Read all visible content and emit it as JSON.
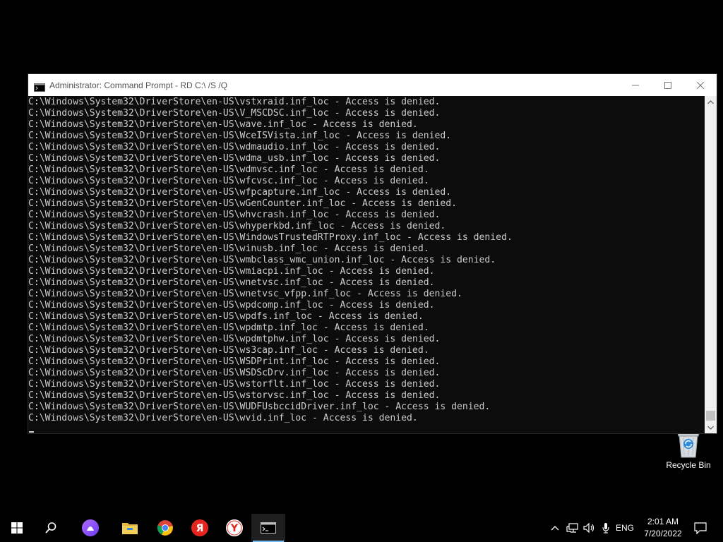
{
  "window": {
    "title": "Administrator: Command Prompt - RD  C:\\ /S /Q",
    "minimize_glyph": "—",
    "maximize_glyph": "☐",
    "close_glyph": "✕"
  },
  "console": {
    "lines": [
      "C:\\Windows\\System32\\DriverStore\\en-US\\vstxraid.inf_loc - Access is denied.",
      "C:\\Windows\\System32\\DriverStore\\en-US\\V_MSCDSC.inf_loc - Access is denied.",
      "C:\\Windows\\System32\\DriverStore\\en-US\\wave.inf_loc - Access is denied.",
      "C:\\Windows\\System32\\DriverStore\\en-US\\WceISVista.inf_loc - Access is denied.",
      "C:\\Windows\\System32\\DriverStore\\en-US\\wdmaudio.inf_loc - Access is denied.",
      "C:\\Windows\\System32\\DriverStore\\en-US\\wdma_usb.inf_loc - Access is denied.",
      "C:\\Windows\\System32\\DriverStore\\en-US\\wdmvsc.inf_loc - Access is denied.",
      "C:\\Windows\\System32\\DriverStore\\en-US\\wfcvsc.inf_loc - Access is denied.",
      "C:\\Windows\\System32\\DriverStore\\en-US\\wfpcapture.inf_loc - Access is denied.",
      "C:\\Windows\\System32\\DriverStore\\en-US\\wGenCounter.inf_loc - Access is denied.",
      "C:\\Windows\\System32\\DriverStore\\en-US\\whvcrash.inf_loc - Access is denied.",
      "C:\\Windows\\System32\\DriverStore\\en-US\\whyperkbd.inf_loc - Access is denied.",
      "C:\\Windows\\System32\\DriverStore\\en-US\\WindowsTrustedRTProxy.inf_loc - Access is denied.",
      "C:\\Windows\\System32\\DriverStore\\en-US\\winusb.inf_loc - Access is denied.",
      "C:\\Windows\\System32\\DriverStore\\en-US\\wmbclass_wmc_union.inf_loc - Access is denied.",
      "C:\\Windows\\System32\\DriverStore\\en-US\\wmiacpi.inf_loc - Access is denied.",
      "C:\\Windows\\System32\\DriverStore\\en-US\\wnetvsc.inf_loc - Access is denied.",
      "C:\\Windows\\System32\\DriverStore\\en-US\\wnetvsc_vfpp.inf_loc - Access is denied.",
      "C:\\Windows\\System32\\DriverStore\\en-US\\wpdcomp.inf_loc - Access is denied.",
      "C:\\Windows\\System32\\DriverStore\\en-US\\wpdfs.inf_loc - Access is denied.",
      "C:\\Windows\\System32\\DriverStore\\en-US\\wpdmtp.inf_loc - Access is denied.",
      "C:\\Windows\\System32\\DriverStore\\en-US\\wpdmtphw.inf_loc - Access is denied.",
      "C:\\Windows\\System32\\DriverStore\\en-US\\ws3cap.inf_loc - Access is denied.",
      "C:\\Windows\\System32\\DriverStore\\en-US\\WSDPrint.inf_loc - Access is denied.",
      "C:\\Windows\\System32\\DriverStore\\en-US\\WSDScDrv.inf_loc - Access is denied.",
      "C:\\Windows\\System32\\DriverStore\\en-US\\wstorflt.inf_loc - Access is denied.",
      "C:\\Windows\\System32\\DriverStore\\en-US\\wstorvsc.inf_loc - Access is denied.",
      "C:\\Windows\\System32\\DriverStore\\en-US\\WUDFUsbccidDriver.inf_loc - Access is denied.",
      "C:\\Windows\\System32\\DriverStore\\en-US\\wvid.inf_loc - Access is denied."
    ]
  },
  "desktop": {
    "recycle_bin_label": "Recycle Bin"
  },
  "taskbar": {
    "language": "ENG",
    "time": "2:01 AM",
    "date": "7/20/2022",
    "yandex_browser_letter": "Я",
    "yandex_letter": "Y"
  },
  "colors": {
    "console_bg": "#0c0c0c",
    "console_text": "#cccccc",
    "taskbar_active_underline": "#76b9ed"
  }
}
